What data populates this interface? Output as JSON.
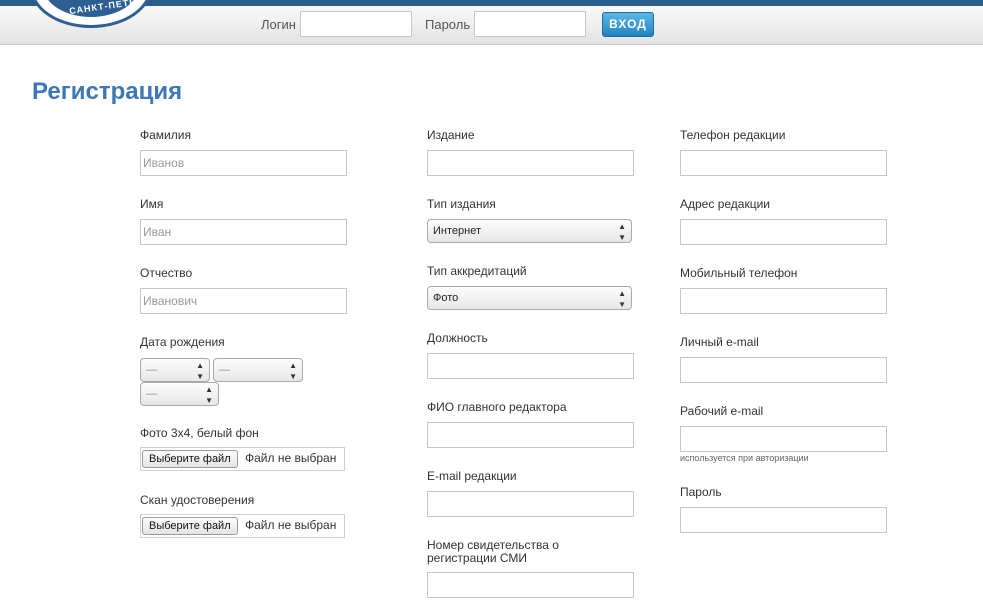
{
  "header": {
    "logo_text": "САНКТ-ПЕТЕР",
    "login_label": "Логин",
    "login_value": "",
    "password_label": "Пароль",
    "password_value": "",
    "login_button": "ВХОД"
  },
  "page_title": "Регистрация",
  "col1": {
    "surname_label": "Фамилия",
    "surname_placeholder": "Иванов",
    "name_label": "Имя",
    "name_placeholder": "Иван",
    "patronymic_label": "Отчество",
    "patronymic_placeholder": "Иванович",
    "birthdate_label": "Дата рождения",
    "day_value": "—",
    "month_value": "—",
    "year_value": "—",
    "photo_label": "Фото 3х4, белый фон",
    "scan_label": "Скан удостоверения",
    "file_button": "Выберите файл",
    "file_status": "Файл не выбран"
  },
  "col2": {
    "edition_label": "Издание",
    "edition_type_label": "Тип издания",
    "edition_type_value": "Интернет",
    "accreditation_label": "Тип аккредитаций",
    "accreditation_value": "Фото",
    "position_label": "Должность",
    "chief_editor_label": "ФИО главного редактора",
    "editorial_email_label": "E-mail редакции",
    "certificate_label_1": "Номер свидетельства о",
    "certificate_label_2": "регистрации СМИ"
  },
  "col3": {
    "editorial_phone_label": "Телефон редакции",
    "editorial_address_label": "Адрес редакции",
    "mobile_label": "Мобильный телефон",
    "personal_email_label": "Личный e-mail",
    "work_email_label": "Рабочий e-mail",
    "work_email_hint": "используется при авторизации",
    "password_label": "Пароль"
  },
  "colors": {
    "title": "#3d77b4",
    "accent": "#2a5d8e",
    "button": "#2283c2"
  }
}
